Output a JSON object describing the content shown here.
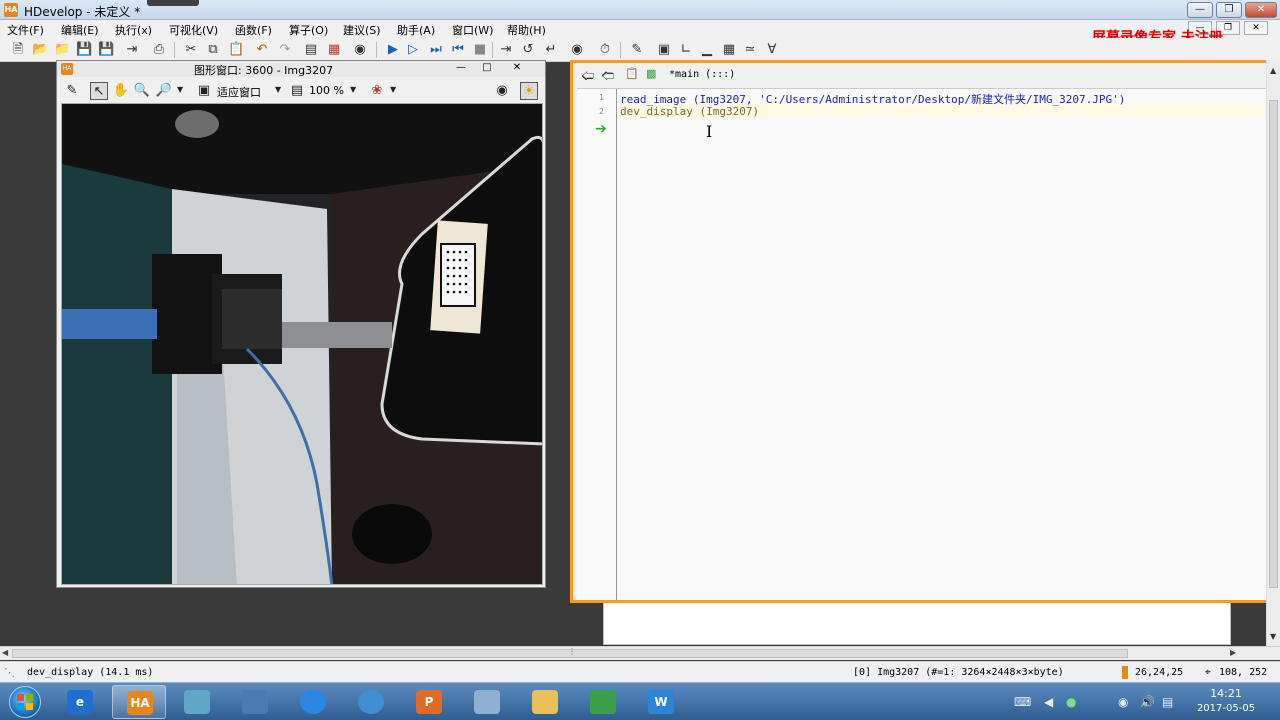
{
  "window": {
    "title": "HDevelop - 未定义 *",
    "app_icon": "HA",
    "controls": [
      "minimize",
      "restore",
      "close"
    ]
  },
  "menubar": {
    "items": [
      "文件(F)",
      "编辑(E)",
      "执行(x)",
      "可视化(V)",
      "函数(F)",
      "算子(O)",
      "建议(S)",
      "助手(A)",
      "窗口(W)",
      "帮助(H)"
    ]
  },
  "watermark": "屏幕录像专家  未注册",
  "toolbar": {
    "icons": [
      "new-file-icon",
      "open-file-icon",
      "open-folder-icon",
      "save-icon",
      "save-all-icon",
      "export-icon",
      "print-icon",
      "cut-icon",
      "copy-icon",
      "paste-icon",
      "undo-icon",
      "redo-icon",
      "insert-icon",
      "delete-icon",
      "binoculars-icon",
      "run-icon",
      "step-over-icon",
      "step-into-icon",
      "step-out-icon",
      "stop-icon",
      "run-to-icon",
      "reset-icon",
      "jump-icon",
      "breakpoint-icon",
      "profiler-icon",
      "inspect-icon",
      "variable-window-icon",
      "graphics-icon",
      "histogram-icon",
      "table-icon",
      "line-profile-icon",
      "feature-icon"
    ]
  },
  "graphics_window": {
    "title": "图形窗口: 3600 - Img3207",
    "fit_label": "适应窗口",
    "zoom_label": "100 %"
  },
  "editor": {
    "proc_label": "*main (:::)",
    "lines": [
      {
        "num": "1",
        "text": "read_image (Img3207, 'C:/Users/Administrator/Desktop/新建文件夹/IMG_3207.JPG')"
      },
      {
        "num": "2",
        "text": "dev_display (Img3207)"
      }
    ]
  },
  "statusbar": {
    "message": "dev_display (14.1 ms)",
    "image_info": "[0] Img3207 (#=1: 3264×2448×3×byte)",
    "pixel_value": "26,24,25",
    "coords": "108, 252"
  },
  "taskbar": {
    "apps": [
      {
        "name": "ie",
        "label": "e",
        "color": "#1f6fd0"
      },
      {
        "name": "halcon",
        "label": "HA",
        "color": "#e8851d"
      },
      {
        "name": "app3",
        "label": "",
        "color": "#5fa7c7"
      },
      {
        "name": "app4",
        "label": "",
        "color": "#4b7ab3"
      },
      {
        "name": "app5",
        "label": "",
        "color": "#2a87e0"
      },
      {
        "name": "app6",
        "label": "",
        "color": "#3f8fd2"
      },
      {
        "name": "powerpoint",
        "label": "P",
        "color": "#e06a26"
      },
      {
        "name": "paint",
        "label": "",
        "color": "#8fb0d0"
      },
      {
        "name": "explorer",
        "label": "",
        "color": "#e9c15a"
      },
      {
        "name": "app10",
        "label": "",
        "color": "#3aa14a"
      },
      {
        "name": "word",
        "label": "W",
        "color": "#2b84d8"
      }
    ],
    "time": "14:21",
    "date": "2017-05-05"
  },
  "colors": {
    "editor_frame": "#ff9a1e",
    "watermark": "#e00000",
    "code_operator": "#1a24b0",
    "code_dev": "#7a6a30"
  }
}
